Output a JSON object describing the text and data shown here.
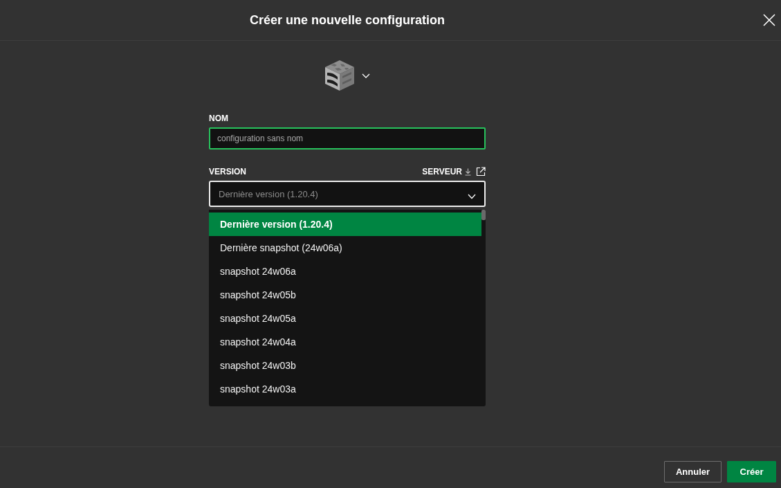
{
  "dialog": {
    "title": "Créer une nouvelle configuration"
  },
  "name_field": {
    "label": "NOM",
    "placeholder": "configuration sans nom",
    "focused": true
  },
  "version_field": {
    "label": "VERSION",
    "link": "SERVEUR",
    "value": "Dernière version (1.20.4)",
    "expanded": true
  },
  "version_options": [
    {
      "label": "Dernière version (1.20.4)",
      "selected": true
    },
    {
      "label": "Dernière snapshot (24w06a)",
      "selected": false
    },
    {
      "label": "snapshot 24w06a",
      "selected": false
    },
    {
      "label": "snapshot 24w05b",
      "selected": false
    },
    {
      "label": "snapshot 24w05a",
      "selected": false
    },
    {
      "label": "snapshot 24w04a",
      "selected": false
    },
    {
      "label": "snapshot 24w03b",
      "selected": false
    },
    {
      "label": "snapshot 24w03a",
      "selected": false
    }
  ],
  "buttons": [
    {
      "label": "Annuler",
      "kind": "secondary"
    },
    {
      "label": "Créer",
      "kind": "primary"
    }
  ]
}
